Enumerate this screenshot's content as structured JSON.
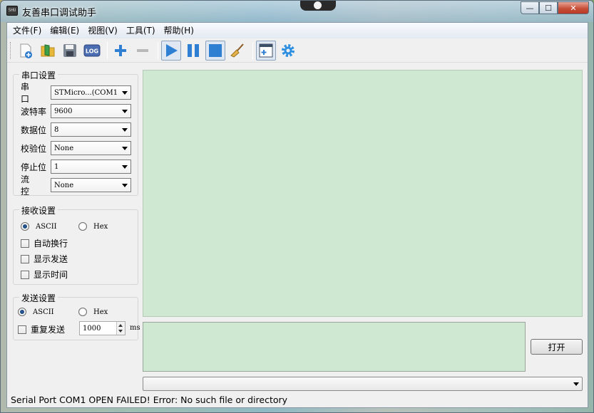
{
  "window": {
    "title": "友善串口调试助手",
    "app_icon_text": "SHU",
    "minimize_glyph": "—",
    "maximize_glyph": "☐",
    "close_glyph": "✕"
  },
  "menu": [
    {
      "label": "文件(F)"
    },
    {
      "label": "编辑(E)"
    },
    {
      "label": "视图(V)"
    },
    {
      "label": "工具(T)"
    },
    {
      "label": "帮助(H)"
    }
  ],
  "toolbar": {
    "icons": [
      "new-file-icon",
      "open-folder-icon",
      "save-icon",
      "log-icon",
      "add-icon",
      "remove-icon",
      "play-icon",
      "pause-icon",
      "stop-icon",
      "broom-clear-icon",
      "add-window-icon",
      "gear-icon"
    ],
    "log_label": "LOG",
    "colors": {
      "blue": "#2f7fd3",
      "gray": "#b9b9b9"
    }
  },
  "serial_settings": {
    "title": "串口设置",
    "fields": [
      {
        "label": "串 口",
        "value": "STMicro...(COM1"
      },
      {
        "label": "波特率",
        "value": "9600"
      },
      {
        "label": "数据位",
        "value": "8"
      },
      {
        "label": "校验位",
        "value": "None"
      },
      {
        "label": "停止位",
        "value": "1"
      },
      {
        "label": "流 控",
        "value": "None"
      }
    ]
  },
  "receive_settings": {
    "title": "接收设置",
    "ascii_label": "ASCII",
    "hex_label": "Hex",
    "selected": "ASCII",
    "checks": [
      {
        "label": "自动换行",
        "checked": false
      },
      {
        "label": "显示发送",
        "checked": false
      },
      {
        "label": "显示时间",
        "checked": false
      }
    ]
  },
  "send_settings": {
    "title": "发送设置",
    "ascii_label": "ASCII",
    "hex_label": "Hex",
    "selected": "ASCII",
    "repeat_label": "重复发送",
    "repeat_checked": false,
    "interval_value": "1000",
    "interval_unit": "ms"
  },
  "colors": {
    "text_area_bg": "#cfe8d2"
  },
  "open_button": {
    "label": "打开"
  },
  "history": {
    "value": ""
  },
  "status": {
    "text": "Serial Port COM1 OPEN FAILED!  Error: No such file or directory"
  }
}
